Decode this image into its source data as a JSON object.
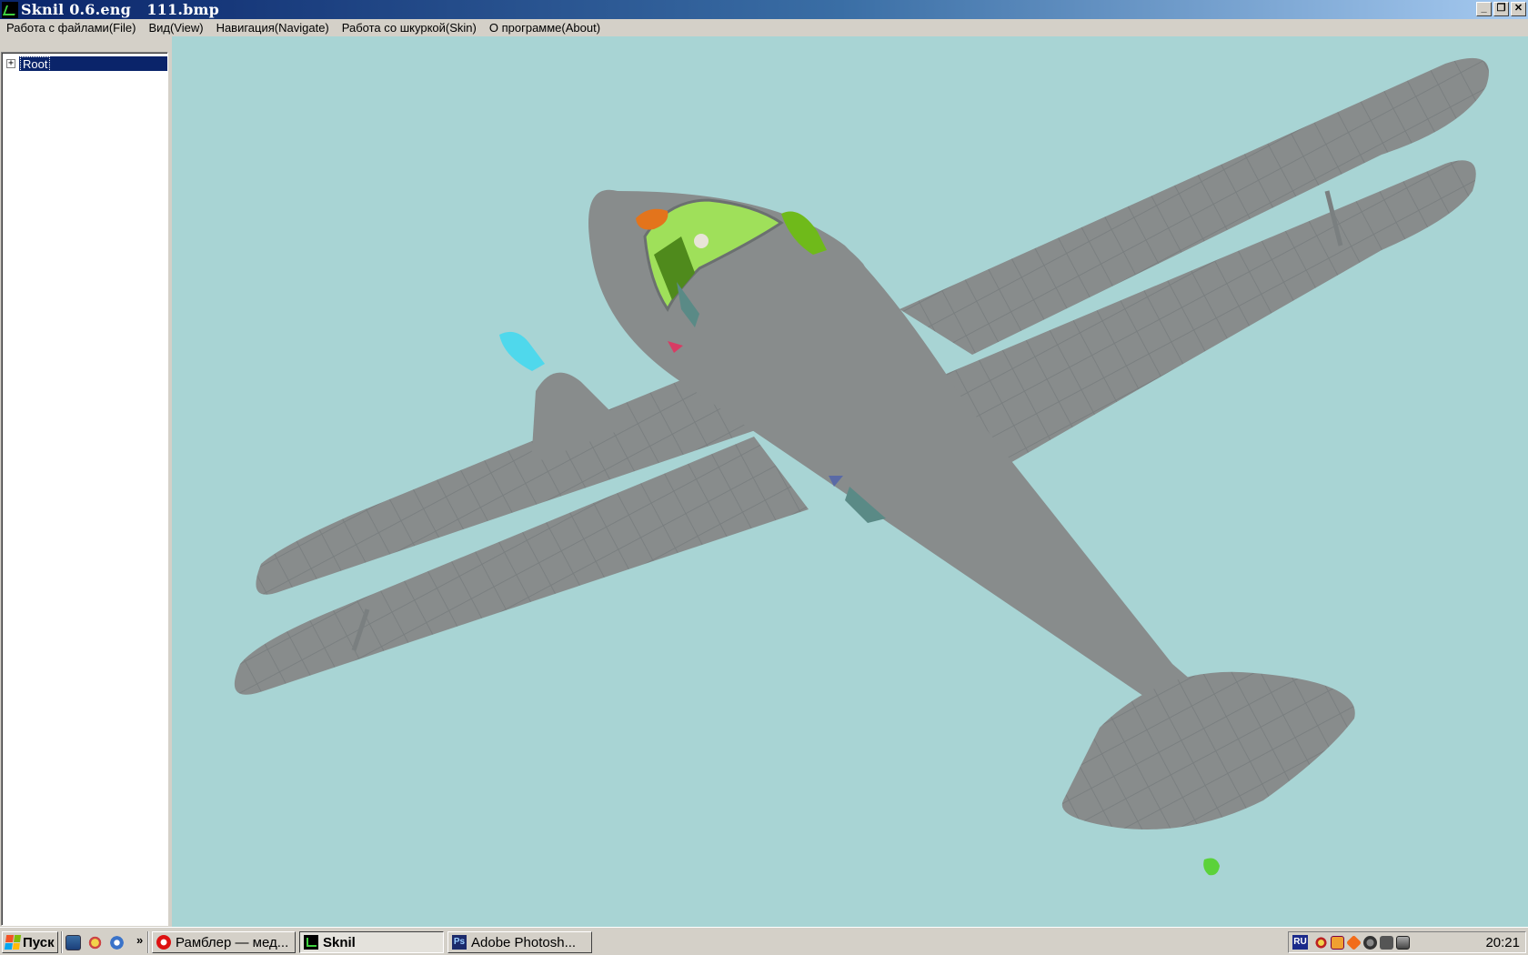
{
  "window": {
    "title": "Sknil 0.6.eng   111.bmp",
    "controls": {
      "minimize": "_",
      "restore": "❐",
      "close": "✕"
    }
  },
  "menu": {
    "items": [
      {
        "label": "Работа с файлами(File)"
      },
      {
        "label": "Вид(View)"
      },
      {
        "label": "Навигация(Navigate)"
      },
      {
        "label": "Работа со шкуркой(Skin)"
      },
      {
        "label": "О программе(About)"
      }
    ]
  },
  "tree": {
    "expander": "+",
    "root_label": "Root"
  },
  "viewport": {
    "background": "#a8d4d4",
    "model_color": "#888c8c",
    "model_panel_line_color": "#7a7f80",
    "highlight_colors": {
      "canopy": "#9fe05a",
      "canopy_dark": "#4f8a1c",
      "right_spinner": "#6fba1a",
      "left_spinner": "#4fd8ec",
      "nose_patch": "#e3741c",
      "marker_red": "#d83c64",
      "marker_blue": "#5a6aa6",
      "teal_panels": "#5a8a86",
      "tail_wheel": "#5bd23a"
    }
  },
  "taskbar": {
    "start_label": "Пуск",
    "quicklaunch_more": "»",
    "tasks": [
      {
        "label": "Рамблер — мед...",
        "icon": "opera-icon"
      },
      {
        "label": "Sknil",
        "icon": "sknil-icon",
        "active": true
      },
      {
        "label": "Adobe Photosh...",
        "icon": "photoshop-icon"
      }
    ],
    "tray_lang": "RU",
    "clock": "20:21"
  }
}
